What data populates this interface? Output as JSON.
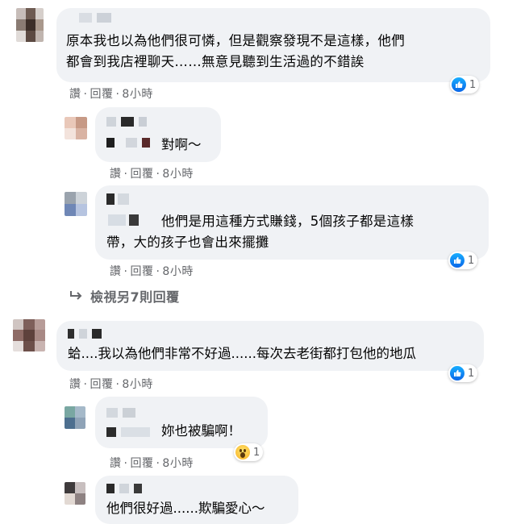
{
  "colors": {
    "bubble": "#f0f2f5",
    "meta_text": "#65676b",
    "like_blue": "#1877f2",
    "wow_yellow": "#f7b125"
  },
  "actions": {
    "read": "讚",
    "reply": "回覆"
  },
  "comments": [
    {
      "text": "原本我也以為他們很可憐，但是觀察發現不是這樣，他們\n都會到我店裡聊天……無意見聽到生活過的不錯誒",
      "time": "8小時",
      "reaction": {
        "icon": "like-icon",
        "count": "1"
      }
    },
    {
      "text": "對啊～",
      "time": "8小時"
    },
    {
      "text": "他們是用這種方式賺錢，5個孩子都是這樣\n帶，大的孩子也會出來擺攤",
      "time": "8小時",
      "reaction": {
        "icon": "like-icon",
        "count": "1"
      }
    },
    {
      "text": "蛤....我以為他們非常不好過......每次去老街都打包他的地瓜",
      "time": "8小時",
      "reaction": {
        "icon": "like-icon",
        "count": "1"
      }
    },
    {
      "text": "妳也被騙啊！",
      "time": "8小時",
      "reaction": {
        "icon": "wow-icon",
        "count": "1"
      }
    },
    {
      "text": "他們很好過......欺騙愛心～"
    }
  ],
  "view_more": "檢視另7則回覆"
}
